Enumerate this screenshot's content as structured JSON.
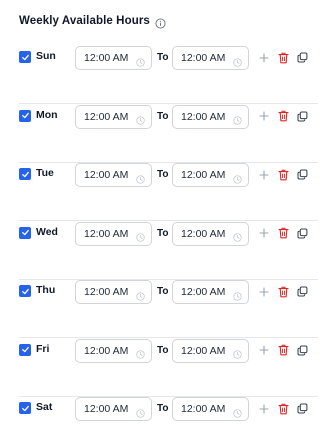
{
  "header": {
    "title": "Weekly Available Hours",
    "info_icon": "info-circle-icon"
  },
  "to_label": "To",
  "colors": {
    "accent": "#2563eb",
    "delete": "#dc2626",
    "muted": "#9ca3af",
    "border": "#d1d5db"
  },
  "days": [
    {
      "label": "Sun",
      "checked": true,
      "start": "12:00 AM",
      "end": "12:00 AM"
    },
    {
      "label": "Mon",
      "checked": true,
      "start": "12:00 AM",
      "end": "12:00 AM"
    },
    {
      "label": "Tue",
      "checked": true,
      "start": "12:00 AM",
      "end": "12:00 AM"
    },
    {
      "label": "Wed",
      "checked": true,
      "start": "12:00 AM",
      "end": "12:00 AM"
    },
    {
      "label": "Thu",
      "checked": true,
      "start": "12:00 AM",
      "end": "12:00 AM"
    },
    {
      "label": "Fri",
      "checked": true,
      "start": "12:00 AM",
      "end": "12:00 AM"
    },
    {
      "label": "Sat",
      "checked": true,
      "start": "12:00 AM",
      "end": "12:00 AM"
    }
  ],
  "icons": {
    "checkbox": "checkbox-checked-icon",
    "clock": "clock-icon",
    "add": "plus-icon",
    "delete": "trash-icon",
    "copy": "copy-icon"
  }
}
